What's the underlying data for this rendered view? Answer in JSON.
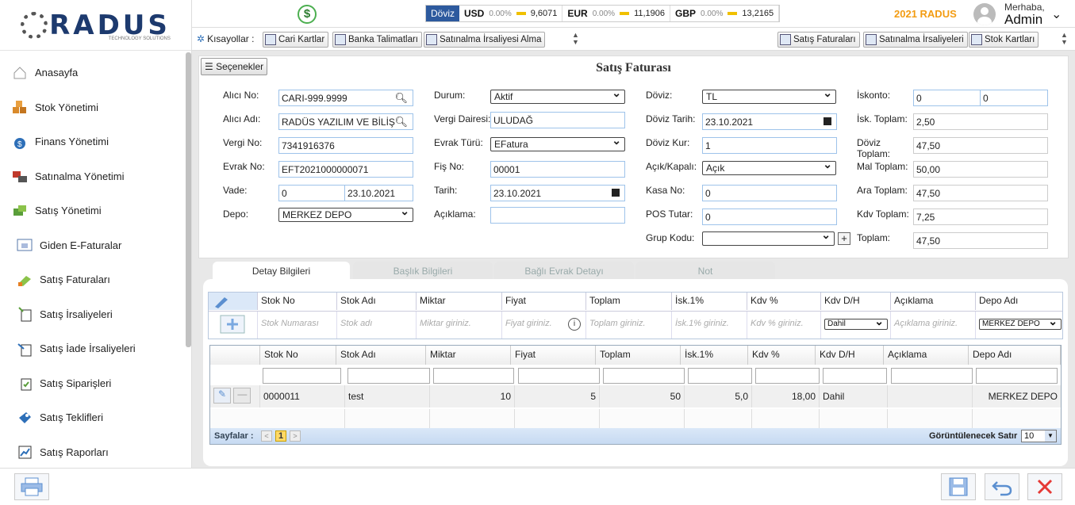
{
  "sidebar": {
    "logo": "RADUS",
    "logo_sub": "TECHNOLOGY SOLUTIONS",
    "items": [
      {
        "label": "Anasayfa",
        "icon": "home-icon"
      },
      {
        "label": "Stok Yönetimi",
        "icon": "boxes-icon"
      },
      {
        "label": "Finans Yönetimi",
        "icon": "money-bag-icon"
      },
      {
        "label": "Satınalma Yönetimi",
        "icon": "purchase-icon"
      },
      {
        "label": "Satış Yönetimi",
        "icon": "sales-icon"
      },
      {
        "label": "Giden E-Faturalar",
        "icon": "einvoice-icon"
      },
      {
        "label": "Satış Faturaları",
        "icon": "invoice-icon"
      },
      {
        "label": "Satış İrsaliyeleri",
        "icon": "waybill-icon"
      },
      {
        "label": "Satış İade İrsaliyeleri",
        "icon": "return-icon"
      },
      {
        "label": "Satış Siparişleri",
        "icon": "order-icon"
      },
      {
        "label": "Satış Teklifleri",
        "icon": "offer-icon"
      },
      {
        "label": "Satış Raporları",
        "icon": "report-icon"
      }
    ]
  },
  "topbar": {
    "currency_label": "Döviz",
    "rates": [
      {
        "code": "USD",
        "pct": "0.00%",
        "value": "9,6071"
      },
      {
        "code": "EUR",
        "pct": "0.00%",
        "value": "11,1906"
      },
      {
        "code": "GBP",
        "pct": "0.00%",
        "value": "13,2165"
      }
    ],
    "year": "2021 RADUS",
    "greeting": "Merhaba,",
    "user": "Admin"
  },
  "shortcuts": {
    "label": "Kısayollar :",
    "left": [
      "Cari Kartlar",
      "Banka Talimatları",
      "Satınalma İrsaliyesi Alma"
    ],
    "right": [
      "Satış Faturaları",
      "Satınalma İrsaliyeleri",
      "Stok Kartları"
    ]
  },
  "form": {
    "options_label": "Seçenekler",
    "title": "Satış Faturası",
    "alici_no_label": "Alıcı No:",
    "alici_no": "CARI-999.9999",
    "alici_adi_label": "Alıcı Adı:",
    "alici_adi": "RADÜS YAZILIM VE BİLİŞ",
    "vergi_no_label": "Vergi No:",
    "vergi_no": "7341916376",
    "evrak_no_label": "Evrak No:",
    "evrak_no": "EFT2021000000071",
    "vade_label": "Vade:",
    "vade": "0",
    "vade_tarih": "23.10.2021",
    "depo_label": "Depo:",
    "depo": "MERKEZ DEPO",
    "durum_label": "Durum:",
    "durum": "Aktif",
    "vergi_dairesi_label": "Vergi Dairesi:",
    "vergi_dairesi": "ULUDAĞ",
    "evrak_turu_label": "Evrak Türü:",
    "evrak_turu": "EFatura",
    "fis_no_label": "Fiş No:",
    "fis_no": "00001",
    "tarih_label": "Tarih:",
    "tarih": "23.10.2021",
    "aciklama_label": "Açıklama:",
    "aciklama": "",
    "doviz_label": "Döviz:",
    "doviz": "TL",
    "doviz_tarih_label": "Döviz Tarih:",
    "doviz_tarih": "23.10.2021",
    "doviz_kur_label": "Döviz Kur:",
    "doviz_kur": "1",
    "acik_kapali_label": "Açık/Kapalı:",
    "acik_kapali": "Açık",
    "kasa_no_label": "Kasa No:",
    "kasa_no": "0",
    "pos_tutar_label": "POS Tutar:",
    "pos_tutar": "0",
    "grup_kodu_label": "Grup Kodu:",
    "grup_kodu": "",
    "iskonto_label": "İskonto:",
    "iskonto1": "0",
    "iskonto2": "0",
    "isk_toplam_label": "İsk. Toplam:",
    "isk_toplam": "2,50",
    "doviz_toplam_label": "Döviz Toplam:",
    "doviz_toplam": "47,50",
    "mal_toplam_label": "Mal Toplam:",
    "mal_toplam": "50,00",
    "ara_toplam_label": "Ara Toplam:",
    "ara_toplam": "47,50",
    "kdv_toplam_label": "Kdv Toplam:",
    "kdv_toplam": "7,25",
    "toplam_label": "Toplam:",
    "toplam": "47,50"
  },
  "tabs": [
    "Detay Bilgileri",
    "Başlık Bilgileri",
    "Bağlı Evrak Detayı",
    "Not"
  ],
  "entry_grid": {
    "headers": [
      "Stok No",
      "Stok Adı",
      "Miktar",
      "Fiyat",
      "Toplam",
      "İsk.1%",
      "Kdv %",
      "Kdv D/H",
      "Açıklama",
      "Depo Adı"
    ],
    "placeholders": [
      "Stok Numarası",
      "Stok adı",
      "Miktar giriniz.",
      "Fiyat giriniz.",
      "Toplam giriniz.",
      "İsk.1% giriniz.",
      "Kdv % giriniz.",
      "",
      "Açıklama giriniz.",
      ""
    ],
    "kdv_dh": "Dahil",
    "depo": "MERKEZ DEPO"
  },
  "detail_grid": {
    "headers": [
      "Stok No",
      "Stok Adı",
      "Miktar",
      "Fiyat",
      "Toplam",
      "İsk.1%",
      "Kdv %",
      "Kdv D/H",
      "Açıklama",
      "Depo Adı"
    ],
    "rows": [
      [
        "0000011",
        "test",
        "10",
        "5",
        "50",
        "5,0",
        "18,00",
        "Dahil",
        "",
        "MERKEZ DEPO"
      ]
    ],
    "pager_label": "Sayfalar :",
    "page": "1",
    "rows_label": "Görüntülenecek Satır",
    "rows_value": "10"
  }
}
